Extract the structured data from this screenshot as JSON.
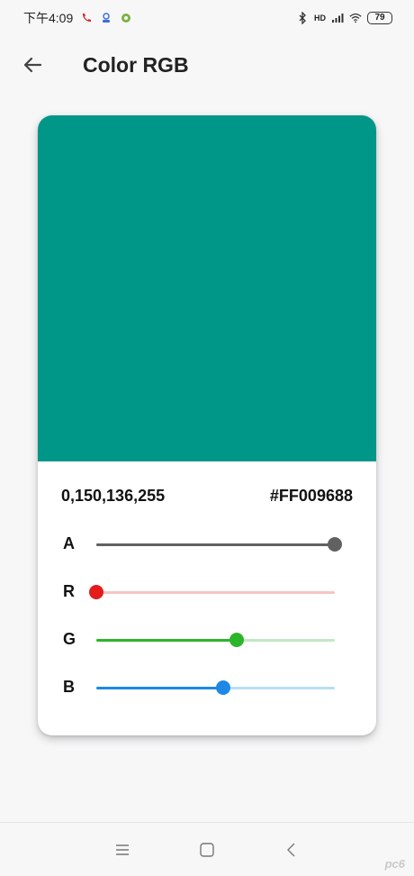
{
  "status_bar": {
    "time": "下午4:09",
    "network": "HD",
    "battery": "79"
  },
  "header": {
    "title": "Color RGB"
  },
  "color": {
    "preview_hex": "#009688",
    "rgba_text": "0,150,136,255",
    "hex_text": "#FF009688"
  },
  "sliders": [
    {
      "label": "A",
      "value": 255,
      "max": 255,
      "color": "#616161",
      "track_color": "#616161"
    },
    {
      "label": "R",
      "value": 0,
      "max": 255,
      "color": "#e41c1c",
      "track_color": "#f4c5c5"
    },
    {
      "label": "G",
      "value": 150,
      "max": 255,
      "color": "#2db52a",
      "track_color": "#c3e8c2"
    },
    {
      "label": "B",
      "value": 136,
      "max": 255,
      "color": "#1e88e5",
      "track_color": "#b9dff2"
    }
  ],
  "watermark": "pc6"
}
